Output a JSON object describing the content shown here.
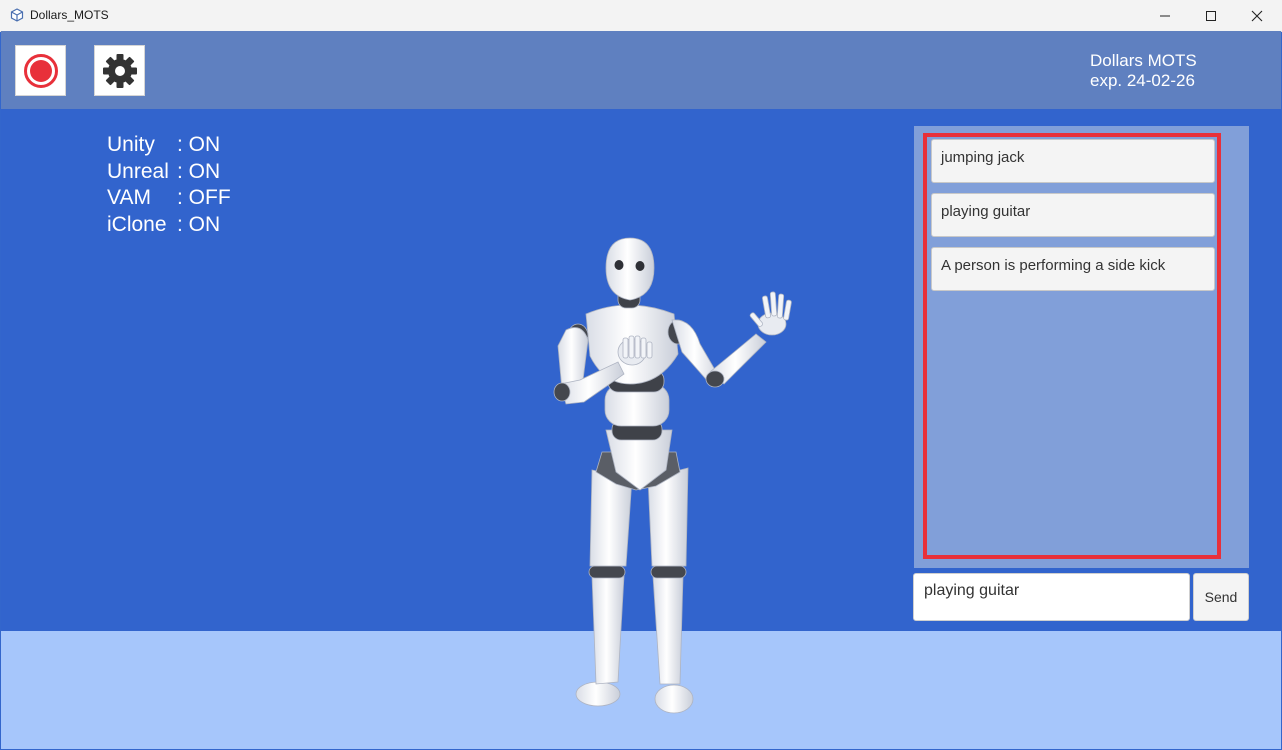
{
  "window": {
    "title": "Dollars_MOTS",
    "icon": "app-cube-icon",
    "controls": [
      "minimize-icon",
      "maximize-icon",
      "close-icon"
    ]
  },
  "header": {
    "record_icon": "record-icon",
    "settings_icon": "gear-icon",
    "brand_name": "Dollars MOTS",
    "expiry": "exp. 24-02-26"
  },
  "status": [
    {
      "name": "Unity",
      "value": ": ON"
    },
    {
      "name": "Unreal",
      "value": ": ON"
    },
    {
      "name": "VAM",
      "value": ": OFF"
    },
    {
      "name": "iClone",
      "value": ": ON"
    }
  ],
  "prompts": [
    "jumping jack",
    "playing guitar",
    "A person is performing a side kick"
  ],
  "input": {
    "value": "playing guitar"
  },
  "send_label": "Send",
  "colors": {
    "scene_background": "#3264cd",
    "header_background": "#5f80c0",
    "floor": "#a6c6fb",
    "panel": "#819fd9",
    "highlight": "#e8303a",
    "record": "#e8303a"
  }
}
